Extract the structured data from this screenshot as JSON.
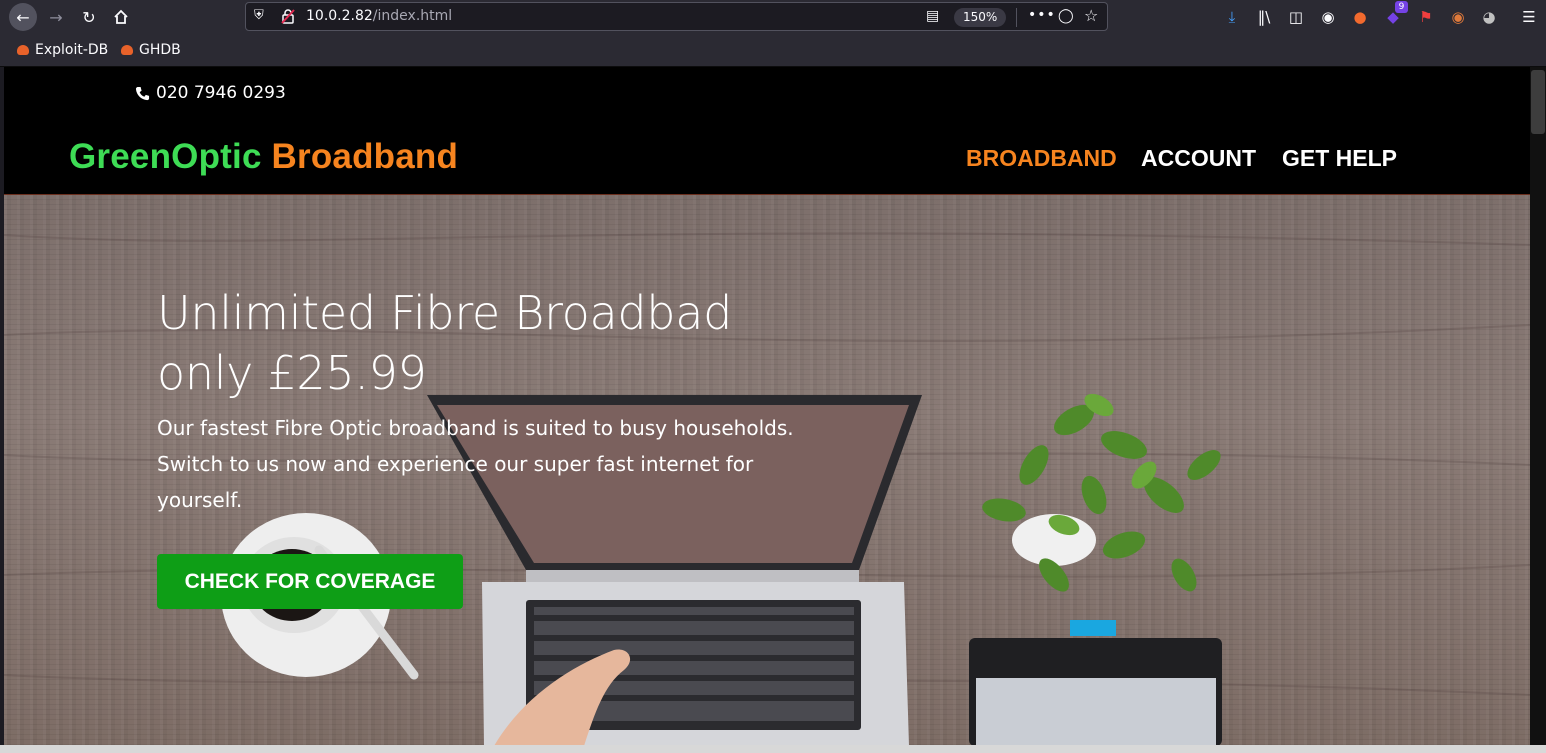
{
  "browser": {
    "url_host": "10.0.2.82",
    "url_path": "/index.html",
    "zoom": "150%",
    "extension_badge": "9",
    "bookmarks": [
      {
        "label": "Exploit-DB"
      },
      {
        "label": "GHDB"
      }
    ],
    "icons": {
      "back": "arrow-left-icon",
      "forward": "arrow-right-icon",
      "reload": "reload-icon",
      "home": "home-icon",
      "tracking": "shield-icon",
      "insecure": "insecure-lock-icon",
      "reader": "reader-view-icon",
      "more": "more-icon",
      "pocket": "pocket-icon",
      "bookmark": "star-icon",
      "downloads": "download-icon",
      "library": "library-icon",
      "sidebar": "sidebar-icon",
      "account": "account-icon",
      "menu": "hamburger-icon"
    }
  },
  "site": {
    "phone": "020 7946 0293",
    "logo_green": "GreenOptic",
    "logo_orange": "Broadband",
    "nav": [
      {
        "label": "BROADBAND",
        "active": true
      },
      {
        "label": "ACCOUNT",
        "active": false
      },
      {
        "label": "GET HELP",
        "active": false
      }
    ],
    "hero": {
      "title_line1": "Unlimited Fibre Broadbad",
      "title_line2": "only £25.99",
      "text": "Our fastest Fibre Optic broadband is suited to busy households. Switch to us now and experience our super fast internet for yourself.",
      "cta": "CHECK FOR COVERAGE"
    },
    "colors": {
      "green": "#3edc55",
      "orange": "#f6841f",
      "button": "#0e9e16"
    }
  }
}
